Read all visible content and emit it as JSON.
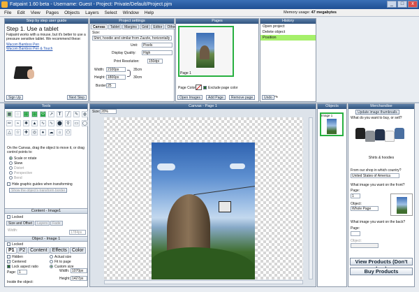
{
  "window": {
    "title": "Fatpaint 1.60 beta  -  Username: Guest  -  Project: Private/Default/Project.pjm",
    "min": "_",
    "max": "□",
    "close": "x"
  },
  "menu": [
    "File",
    "Edit",
    "View",
    "Pages",
    "Objects",
    "Layers",
    "Select",
    "Window",
    "Help"
  ],
  "memory": {
    "label": "Memory usage:",
    "value": "47 megabytes"
  },
  "guide": {
    "header": "Step by step user guide",
    "step_title": "Step 1. Use a tablet",
    "text": "Fatpaint works with a mouse, but it's better to use a pressure sensitive tablet. We recommend these:",
    "link1": "Wacom Bamboo Pen",
    "link2": "Wacom Bamboo Pen & Touch",
    "signup": "Sign Up",
    "next": "Next Step"
  },
  "project": {
    "header": "Project settings",
    "tabs": [
      "Canvas",
      "Tablet",
      "Margins",
      "Grid",
      "Editor",
      "Other"
    ],
    "size_label": "Size:",
    "size_value": "Shirt, hoodie and similar from Zazzle, horizontally",
    "unit_label": "Unit:",
    "unit_value": "Pixels",
    "quality_label": "Display Quality:",
    "quality_value": "High",
    "resolution_label": "Print Resolution:",
    "resolution_value": "150dpi",
    "width_label": "Width:",
    "width_value": "2100px",
    "width_cm": "35cm",
    "height_label": "Height:",
    "height_value": "1800px",
    "height_cm": "30cm",
    "border_label": "Border:",
    "border_value": "25"
  },
  "pages": {
    "header": "Pages",
    "thumb_label": "Page 1",
    "color_label": "Page Color:",
    "exclude_label": "Exclude page color",
    "open_images": "Open Images",
    "add_page": "Add Page",
    "remove_page": "Remove page"
  },
  "history": {
    "header": "History",
    "items": [
      "Open project",
      "Delete object",
      "Position"
    ],
    "undo": "Undo"
  },
  "tools": {
    "header": "Tools",
    "glyphs": [
      "▦",
      "◌",
      "⬚",
      "⬚",
      "⬭",
      "↗",
      "T",
      "╱",
      "✎",
      "◍",
      "✏",
      "⌁",
      "✱",
      "▲",
      "∿",
      "∿",
      "⬤",
      "⚲",
      "▭",
      "◯",
      "△",
      "☆",
      "✚",
      "◎",
      "♠",
      "☁",
      "⌂",
      "⬠"
    ],
    "instruction": "On the Canvas, drag the object to move it, or drag control points to:",
    "options": [
      "Scale or rotate",
      "Skew",
      "Distort",
      "Perspective",
      "Bend"
    ],
    "hide_guides": "Hide graphic guides when transforming",
    "guides_btn": "Show the object's transform border"
  },
  "content": {
    "header": "Content - Image1",
    "locked": "Locked",
    "size_offset": "Size and Offset",
    "layers": "Layers",
    "fade": "Fade",
    "width_label": "Width:",
    "width_value": "1784px"
  },
  "object": {
    "header": "Object - Image 1",
    "locked": "Locked",
    "tabs": [
      "P1",
      "P2",
      "Content",
      "Effects",
      "Color"
    ],
    "hidden": "Hidden",
    "centered": "Centered",
    "lock_ratio": "Lock aspect ratio",
    "actual_size": "Actual size",
    "fit_page": "Fit to page",
    "custom_size": "Custom size",
    "page_label": "Page:",
    "page_value": "1",
    "width_label": "Width:",
    "width_value": "1070px",
    "height_label": "Height:",
    "height_value": "1427px",
    "inside_label": "Inside the object:"
  },
  "canvas": {
    "header": "Canvas  -  Page 1",
    "size_label": "Size:",
    "size_value": "20%"
  },
  "objects": {
    "header": "Objects",
    "item": "Image 1"
  },
  "merch": {
    "header": "Merchandise",
    "update_btn": "Update image thumbnails",
    "q1": "What do you want to buy, or sell?",
    "shirts_label": "Shirts & hoodies",
    "country_q": "From our shop in which country?",
    "country_value": "United States of America",
    "front_q": "What image you want on the front?",
    "page_label": "Page:",
    "page_value": "1",
    "object_label": "Object:",
    "object_value": "Whole Page",
    "back_q": "What image you want on the back?",
    "back_page_label": "Page:",
    "back_object_label": "Object:",
    "view_products": "View Products (Don't buy)",
    "buy_products": "Buy Products"
  },
  "colors": {
    "accent": "#2f537e",
    "selection_green": "#27b040",
    "history_selected": "#a6f06a"
  }
}
